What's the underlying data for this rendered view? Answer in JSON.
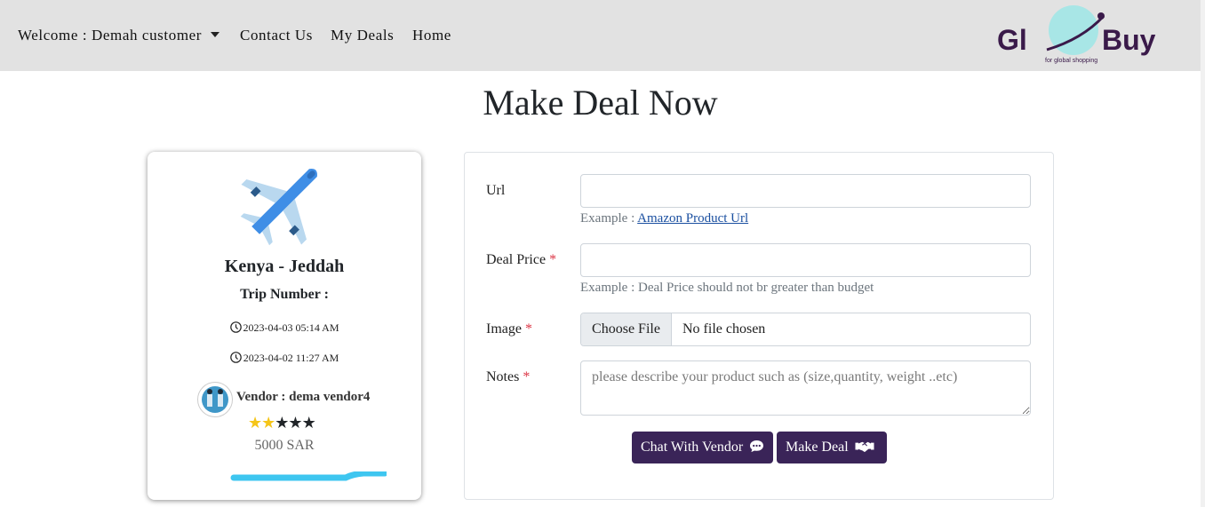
{
  "navbar": {
    "welcome": "Welcome : Demah customer",
    "contact": "Contact Us",
    "my_deals": "My Deals",
    "home": "Home",
    "logo_text_left": "Gl",
    "logo_text_right": "Buy",
    "logo_tagline": "for global shopping"
  },
  "page": {
    "title": "Make Deal Now"
  },
  "trip": {
    "route": "Kenya - Jeddah",
    "trip_number_label": "Trip Number :",
    "date1": "2023-04-03 05:14 AM",
    "date2": "2023-04-02 11:27 AM",
    "vendor": "Vendor : dema vendor4",
    "rating": 2,
    "rating_max": 5,
    "budget": "5000 SAR",
    "icons": [
      "airplane-icon",
      "clock-icon",
      "vendor-avatar",
      "star-icon"
    ]
  },
  "form": {
    "url_label": "Url",
    "url_value": "",
    "url_help_prefix": "Example :",
    "url_help_link": "Amazon Product Url",
    "price_label": "Deal Price",
    "price_value": "",
    "price_help": "Example : Deal Price should not br greater than budget",
    "image_label": "Image",
    "file_button": "Choose File",
    "file_status": "No file chosen",
    "notes_label": "Notes",
    "notes_placeholder": "please describe your product such as (size,quantity, weight ..etc)",
    "required_mark": "*",
    "chat_button": "Chat With Vendor",
    "deal_button": "Make Deal"
  },
  "colors": {
    "navbar_bg": "#e2e2e2",
    "brand_purple": "#3a2458",
    "logo_accent": "#a8e6e6",
    "progress": "#3ec6f0",
    "star": "#f5c518",
    "required": "#dc3545"
  }
}
